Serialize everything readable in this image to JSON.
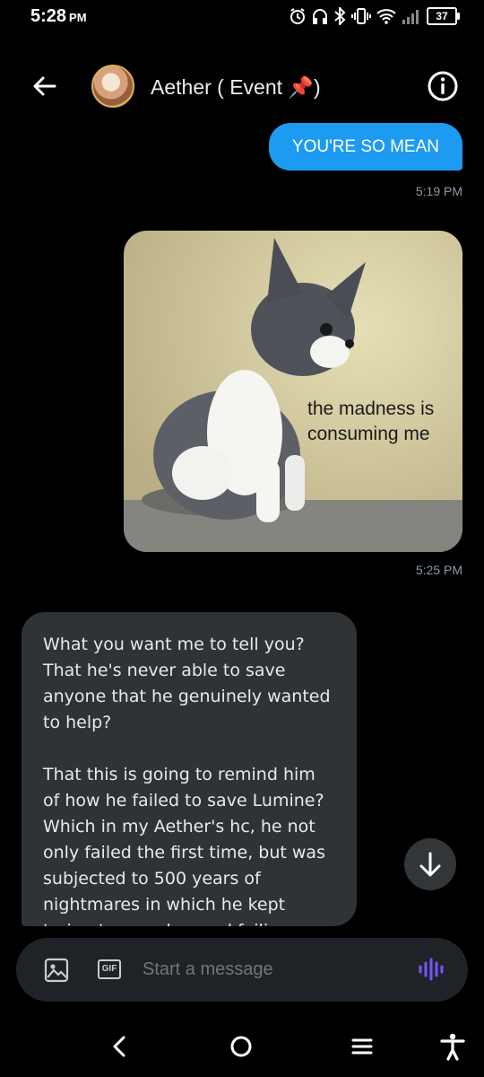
{
  "status_bar": {
    "time": "5:28",
    "ampm": "PM",
    "battery": "37"
  },
  "header": {
    "title": "Aether ( Event 📌)"
  },
  "messages": {
    "sent_text": "YOU'RE SO MEAN",
    "sent_time": "5:19 PM",
    "image_caption_line1": "the madness is",
    "image_caption_line2": "consuming me",
    "image_time": "5:25 PM",
    "received_p1": "What you want me to tell you? That he's never able to save anyone that he genuinely wanted to help?",
    "received_p2": "That this is going to remind him of how he failed to save Lumine? Which in my Aether's hc, he not only failed the first time, but was subjected to 500 years of nightmares in which he kept trying to save her and failing every single time"
  },
  "composer": {
    "placeholder": "Start a message",
    "gif_label": "GIF"
  },
  "colors": {
    "accent": "#1d9bf0",
    "voice_accent": "#7856ff",
    "bubble_received": "#2f3336"
  },
  "icons": [
    "back-arrow-icon",
    "info-icon",
    "image-icon",
    "gif-icon",
    "voice-icon",
    "arrow-down-icon",
    "nav-back-icon",
    "nav-home-icon",
    "nav-recents-icon",
    "accessibility-icon"
  ]
}
